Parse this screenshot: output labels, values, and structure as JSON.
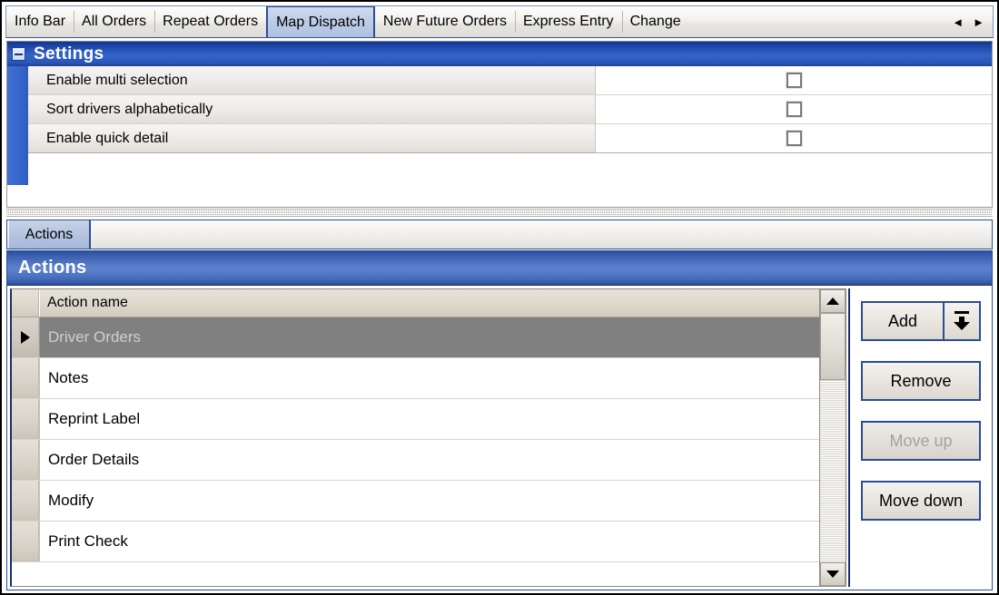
{
  "tabs": {
    "items": [
      {
        "label": "Info Bar",
        "active": false
      },
      {
        "label": "All Orders",
        "active": false
      },
      {
        "label": "Repeat Orders",
        "active": false
      },
      {
        "label": "Map Dispatch",
        "active": true
      },
      {
        "label": "New Future Orders",
        "active": false
      },
      {
        "label": "Express Entry",
        "active": false
      },
      {
        "label": "Change",
        "active": false
      }
    ],
    "nav_prev": "◄",
    "nav_next": "►"
  },
  "settings": {
    "title": "Settings",
    "collapse_icon": "minus-icon",
    "rows": [
      {
        "label": "Enable multi selection",
        "checked": false
      },
      {
        "label": "Sort drivers alphabetically",
        "checked": false
      },
      {
        "label": "Enable quick detail",
        "checked": false
      }
    ]
  },
  "lower_tabs": {
    "items": [
      {
        "label": "Actions",
        "active": true
      }
    ]
  },
  "actions": {
    "title": "Actions",
    "grid": {
      "column_header": "Action name",
      "rows": [
        {
          "name": "Driver Orders",
          "selected": true
        },
        {
          "name": "Notes",
          "selected": false
        },
        {
          "name": "Reprint Label",
          "selected": false
        },
        {
          "name": "Order Details",
          "selected": false
        },
        {
          "name": "Modify",
          "selected": false
        },
        {
          "name": "Print Check",
          "selected": false
        }
      ]
    },
    "scrollbar": {
      "up_icon": "triangle-up-icon",
      "down_icon": "triangle-down-icon"
    },
    "buttons": {
      "add": "Add",
      "add_dropdown_icon": "insert-down-arrow-icon",
      "remove": "Remove",
      "move_up": "Move up",
      "move_down": "Move down"
    }
  },
  "colors": {
    "accent_blue": "#2a4d94",
    "header_blue": "#3464c8",
    "selection_gray": "#808080",
    "panel_bg": "#ffffff"
  }
}
